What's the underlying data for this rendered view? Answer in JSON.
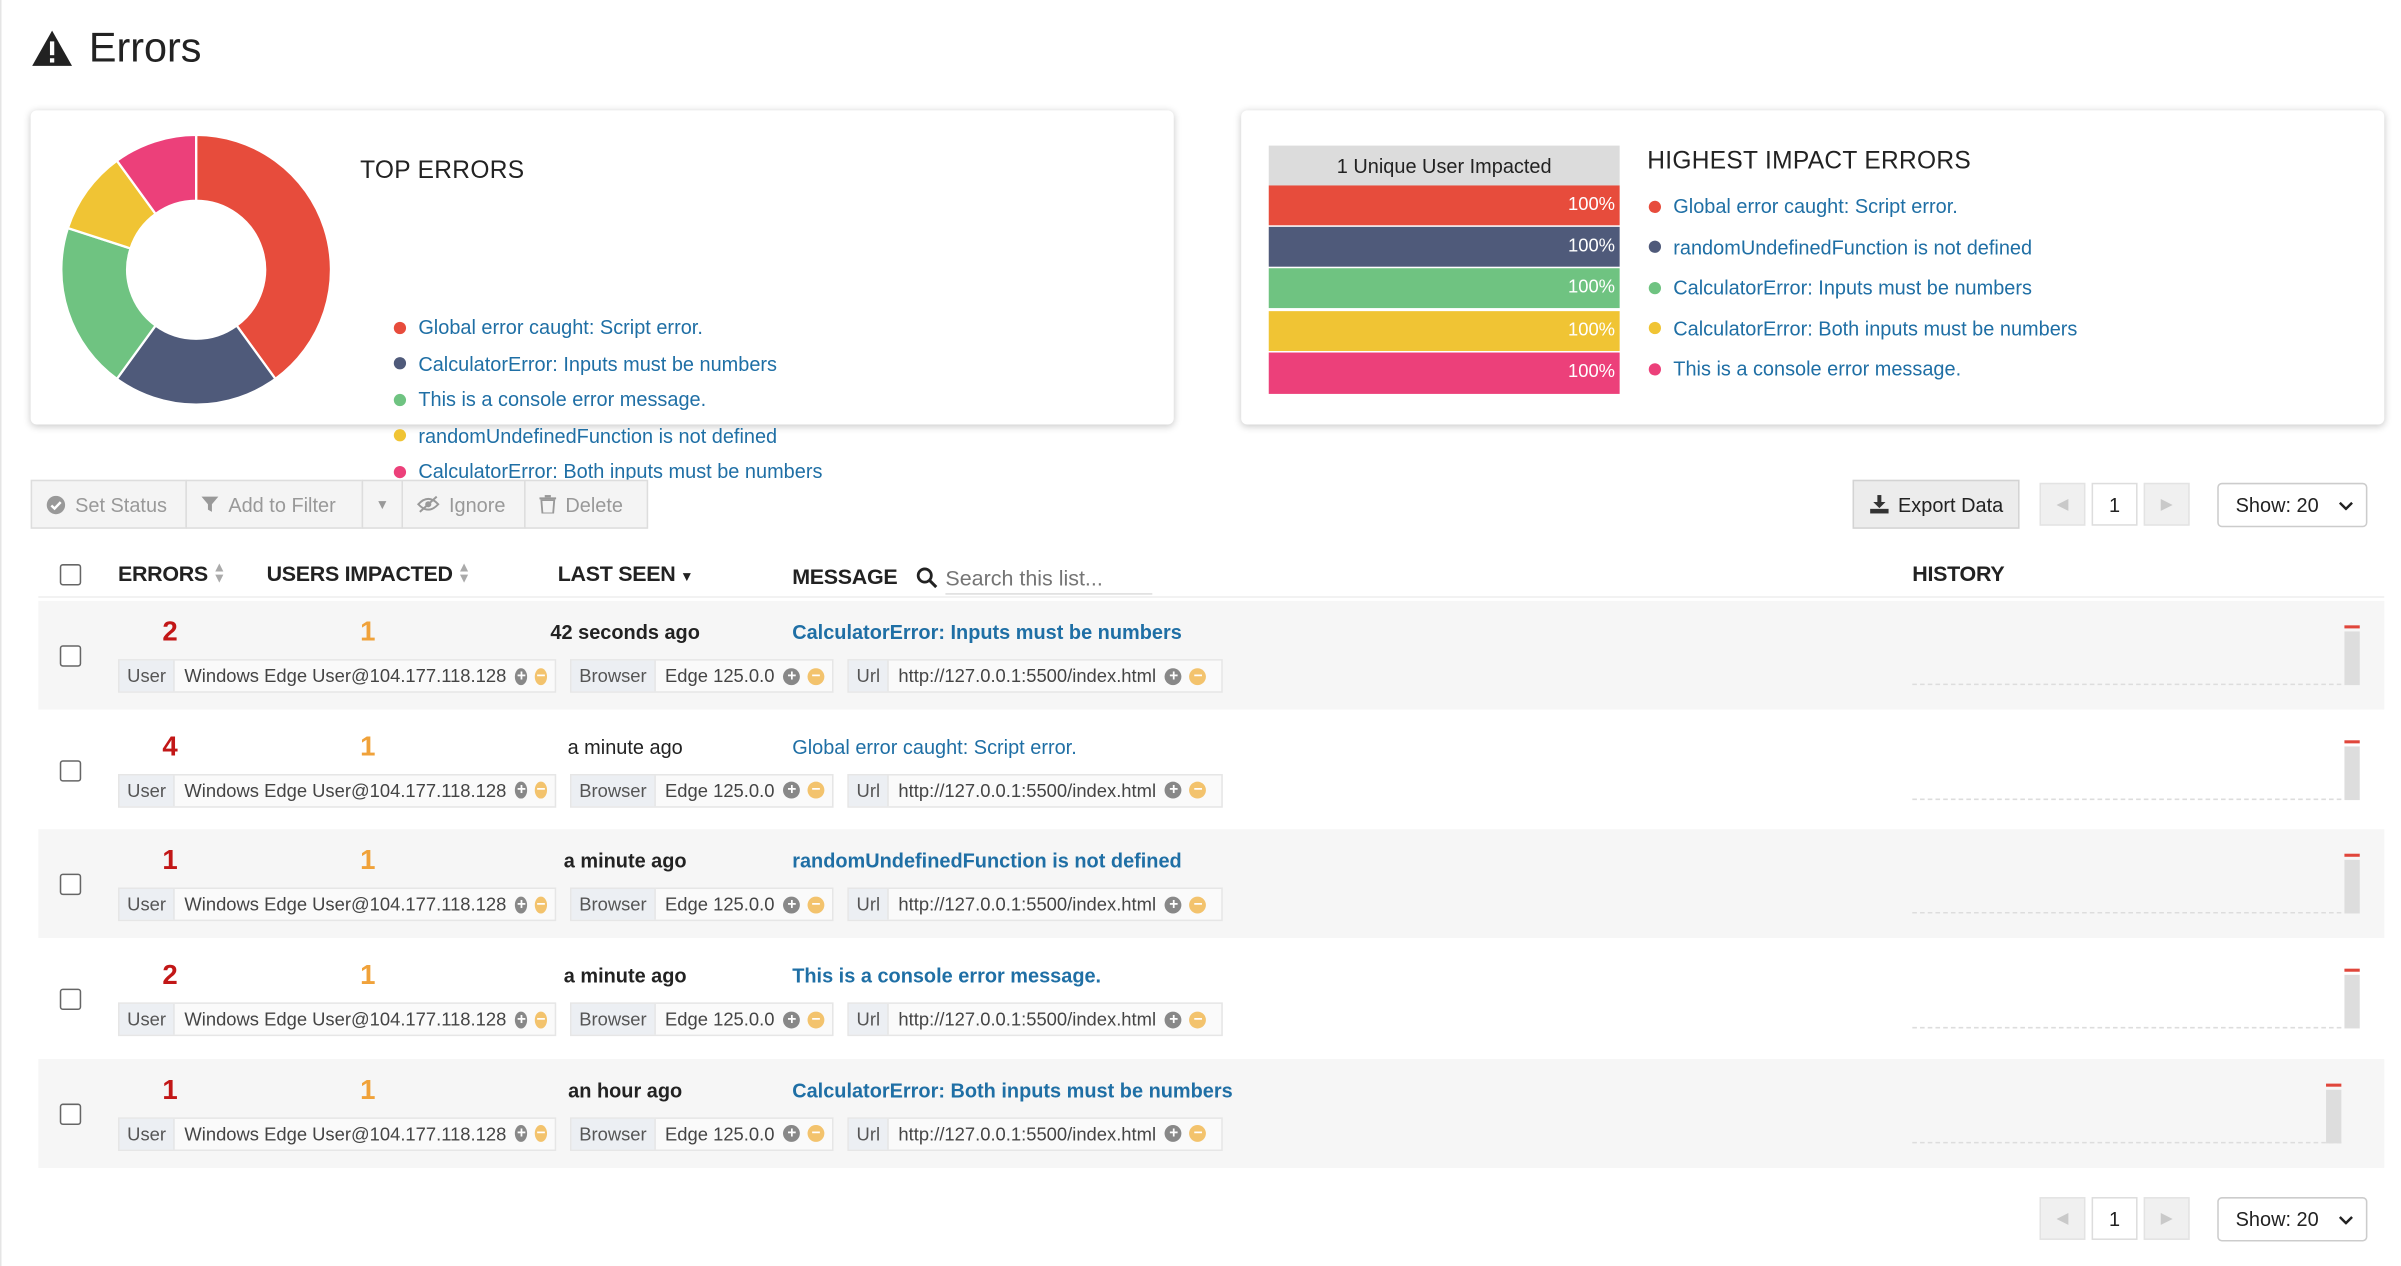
{
  "page": {
    "title": "Errors",
    "icon": "warning-icon"
  },
  "top_errors": {
    "title": "TOP ERRORS",
    "items": [
      {
        "label": "Global error caught: Script error.",
        "color": "#e74c3c"
      },
      {
        "label": "CalculatorError: Inputs must be numbers",
        "color": "#4f5a7a"
      },
      {
        "label": "This is a console error message.",
        "color": "#6fc381"
      },
      {
        "label": "randomUndefinedFunction is not defined",
        "color": "#f0c434"
      },
      {
        "label": "CalculatorError: Both inputs must be numbers",
        "color": "#ec407a"
      }
    ],
    "shares": [
      0.4,
      0.2,
      0.2,
      0.1,
      0.1
    ]
  },
  "highest_impact": {
    "title": "HIGHEST IMPACT ERRORS",
    "header": "1 Unique User Impacted",
    "bars": [
      {
        "label": "100%",
        "color": "#e74c3c"
      },
      {
        "label": "100%",
        "color": "#4f5a7a"
      },
      {
        "label": "100%",
        "color": "#6fc381"
      },
      {
        "label": "100%",
        "color": "#f0c434"
      },
      {
        "label": "100%",
        "color": "#ec407a"
      }
    ],
    "items": [
      {
        "label": "Global error caught: Script error.",
        "color": "#e74c3c"
      },
      {
        "label": "randomUndefinedFunction is not defined",
        "color": "#4f5a7a"
      },
      {
        "label": "CalculatorError: Inputs must be numbers",
        "color": "#6fc381"
      },
      {
        "label": "CalculatorError: Both inputs must be numbers",
        "color": "#f0c434"
      },
      {
        "label": "This is a console error message.",
        "color": "#ec407a"
      }
    ]
  },
  "toolbar": {
    "set_status": "Set Status",
    "add_filter": "Add to Filter",
    "ignore": "Ignore",
    "delete": "Delete",
    "export": "Export Data"
  },
  "pagination": {
    "page": "1",
    "show": "Show: 20"
  },
  "columns": {
    "errors": "ERRORS",
    "users": "USERS IMPACTED",
    "last_seen": "LAST SEEN",
    "message": "MESSAGE",
    "search_placeholder": "Search this list...",
    "history": "HISTORY"
  },
  "tags": {
    "user_key": "User",
    "browser_key": "Browser",
    "url_key": "Url"
  },
  "rows": [
    {
      "errors": "2",
      "users": "1",
      "last_seen": "42 seconds ago",
      "message": "CalculatorError: Inputs must be numbers",
      "bold": true,
      "user": "Windows Edge User@104.177.118.128",
      "browser": "Edge 125.0.0",
      "url": "http://127.0.0.1:5500/index.html"
    },
    {
      "errors": "4",
      "users": "1",
      "last_seen": "a minute ago",
      "message": "Global error caught: Script error.",
      "bold": false,
      "user": "Windows Edge User@104.177.118.128",
      "browser": "Edge 125.0.0",
      "url": "http://127.0.0.1:5500/index.html"
    },
    {
      "errors": "1",
      "users": "1",
      "last_seen": "a minute ago",
      "message": "randomUndefinedFunction is not defined",
      "bold": true,
      "user": "Windows Edge User@104.177.118.128",
      "browser": "Edge 125.0.0",
      "url": "http://127.0.0.1:5500/index.html"
    },
    {
      "errors": "2",
      "users": "1",
      "last_seen": "a minute ago",
      "message": "This is a console error message.",
      "bold": true,
      "user": "Windows Edge User@104.177.118.128",
      "browser": "Edge 125.0.0",
      "url": "http://127.0.0.1:5500/index.html"
    },
    {
      "errors": "1",
      "users": "1",
      "last_seen": "an hour ago",
      "message": "CalculatorError: Both inputs must be numbers",
      "bold": true,
      "user": "Windows Edge User@104.177.118.128",
      "browser": "Edge 125.0.0",
      "url": "http://127.0.0.1:5500/index.html"
    }
  ]
}
